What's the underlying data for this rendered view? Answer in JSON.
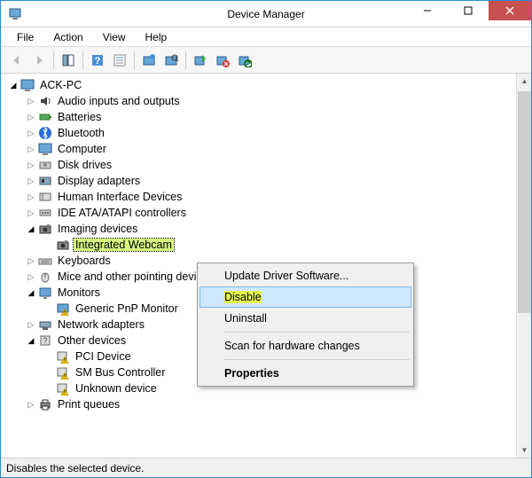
{
  "window": {
    "title": "Device Manager"
  },
  "menubar": {
    "file": "File",
    "action": "Action",
    "view": "View",
    "help": "Help"
  },
  "tree": {
    "root": "ACK-PC",
    "nodes": [
      {
        "label": "Audio inputs and outputs",
        "expanded": false
      },
      {
        "label": "Batteries",
        "expanded": false
      },
      {
        "label": "Bluetooth",
        "expanded": false
      },
      {
        "label": "Computer",
        "expanded": false
      },
      {
        "label": "Disk drives",
        "expanded": false
      },
      {
        "label": "Display adapters",
        "expanded": false
      },
      {
        "label": "Human Interface Devices",
        "expanded": false
      },
      {
        "label": "IDE ATA/ATAPI controllers",
        "expanded": false
      },
      {
        "label": "Imaging devices",
        "expanded": true,
        "children": [
          {
            "label": "Integrated Webcam",
            "selected": true
          }
        ]
      },
      {
        "label": "Keyboards",
        "expanded": false
      },
      {
        "label": "Mice and other pointing devices",
        "expanded": false
      },
      {
        "label": "Monitors",
        "expanded": true,
        "children": [
          {
            "label": "Generic PnP Monitor",
            "warning": true
          }
        ]
      },
      {
        "label": "Network adapters",
        "expanded": false
      },
      {
        "label": "Other devices",
        "expanded": true,
        "children": [
          {
            "label": "PCI Device",
            "warning": true
          },
          {
            "label": "SM Bus Controller",
            "warning": true
          },
          {
            "label": "Unknown device",
            "warning": true
          }
        ]
      },
      {
        "label": "Print queues",
        "expanded": false
      }
    ]
  },
  "context_menu": {
    "update": "Update Driver Software...",
    "disable": "Disable",
    "uninstall": "Uninstall",
    "scan": "Scan for hardware changes",
    "properties": "Properties"
  },
  "statusbar": {
    "text": "Disables the selected device."
  }
}
